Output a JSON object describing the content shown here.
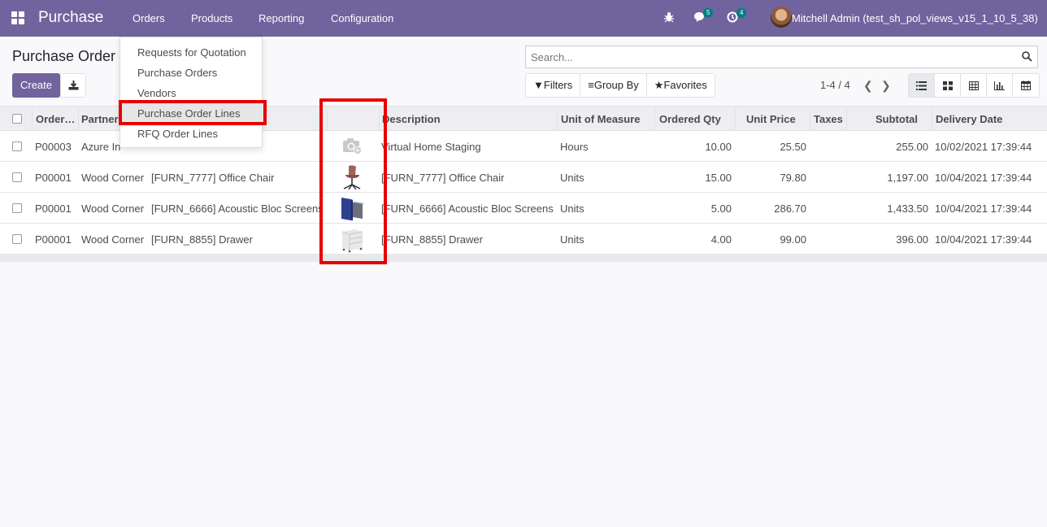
{
  "navbar": {
    "brand": "Purchase",
    "menus": [
      "Orders",
      "Products",
      "Reporting",
      "Configuration"
    ],
    "chat_count": "5",
    "activity_count": "4",
    "user": "Mitchell Admin (test_sh_pol_views_v15_1_10_5_38)"
  },
  "control": {
    "breadcrumb": "Purchase Order",
    "create_label": "Create",
    "search_placeholder": "Search...",
    "filters_label": "Filters",
    "groupby_label": "Group By",
    "favorites_label": "Favorites",
    "pager": "1-4 / 4"
  },
  "dropdown": {
    "items": [
      "Requests for Quotation",
      "Purchase Orders",
      "Vendors",
      "Purchase Order Lines",
      "RFQ Order Lines"
    ],
    "active_item": "Purchase Order Lines"
  },
  "table": {
    "headers": {
      "order": "Order…",
      "partner": "Partner",
      "description": "Description",
      "uom": "Unit of Measure",
      "ordered_qty": "Ordered Qty",
      "unit_price": "Unit Price",
      "taxes": "Taxes",
      "subtotal": "Subtotal",
      "delivery_date": "Delivery Date"
    },
    "rows": [
      {
        "order": "P00003",
        "partner": "Azure In",
        "product": "",
        "image": "camera-placeholder-icon",
        "description": "Virtual Home Staging",
        "uom": "Hours",
        "qty": "10.00",
        "price": "25.50",
        "taxes": "",
        "subtotal": "255.00",
        "date": "10/02/2021 17:39:44"
      },
      {
        "order": "P00001",
        "partner": "Wood Corner",
        "product": "[FURN_7777] Office Chair",
        "image": "office-chair-image",
        "description": "[FURN_7777] Office Chair",
        "uom": "Units",
        "qty": "15.00",
        "price": "79.80",
        "taxes": "",
        "subtotal": "1,197.00",
        "date": "10/04/2021 17:39:44"
      },
      {
        "order": "P00001",
        "partner": "Wood Corner",
        "product": "[FURN_6666] Acoustic Bloc Screens",
        "image": "acoustic-screen-image",
        "description": "[FURN_6666] Acoustic Bloc Screens",
        "uom": "Units",
        "qty": "5.00",
        "price": "286.70",
        "taxes": "",
        "subtotal": "1,433.50",
        "date": "10/04/2021 17:39:44"
      },
      {
        "order": "P00001",
        "partner": "Wood Corner",
        "product": "[FURN_8855] Drawer",
        "image": "drawer-image",
        "description": "[FURN_8855] Drawer",
        "uom": "Units",
        "qty": "4.00",
        "price": "99.00",
        "taxes": "",
        "subtotal": "396.00",
        "date": "10/04/2021 17:39:44"
      }
    ]
  },
  "colors": {
    "brand": "#71639e",
    "highlight": "#e60000",
    "badge": "#017e84"
  }
}
